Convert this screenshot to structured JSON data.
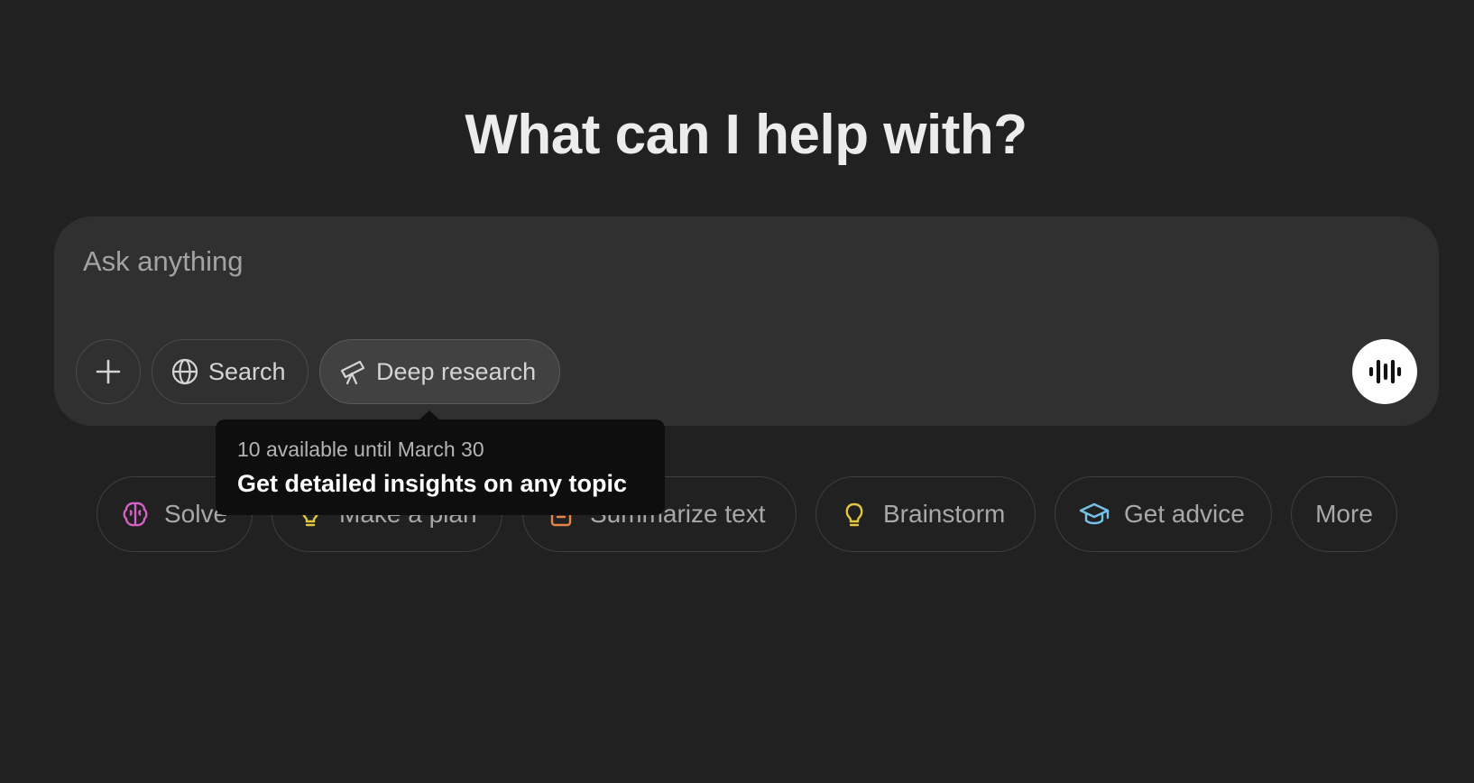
{
  "main": {
    "heading": "What can I help with?"
  },
  "composer": {
    "placeholder": "Ask anything",
    "tools": {
      "search_label": "Search",
      "research_label": "Deep research"
    }
  },
  "tooltip": {
    "subtitle": "10 available until March 30",
    "title": "Get detailed insights on any topic"
  },
  "suggestions": [
    {
      "label": "Solve",
      "icon": "brain-icon",
      "color": "#d660c8"
    },
    {
      "label": "Make a plan",
      "icon": "lightbulb-icon",
      "color": "#e2c541"
    },
    {
      "label": "Summarize text",
      "icon": "document-icon",
      "color": "#e8864a"
    },
    {
      "label": "Brainstorm",
      "icon": "lightbulb-icon",
      "color": "#e2c541"
    },
    {
      "label": "Get advice",
      "icon": "graduation-cap-icon",
      "color": "#76c3ea"
    },
    {
      "label": "More",
      "icon": "",
      "color": "#a8a8a8"
    }
  ],
  "colors": {
    "background": "#212121",
    "composer": "#303030",
    "tooltip": "#0e0e0e",
    "voice_button": "#ffffff"
  }
}
